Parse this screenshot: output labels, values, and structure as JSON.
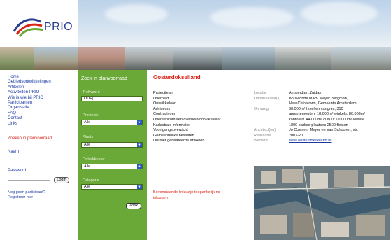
{
  "logo": {
    "text": "PRIO"
  },
  "leftnav": {
    "items": [
      "Home",
      "Gebiedsontwikkelingen",
      "Artikelen",
      "Activiteiten PRIO",
      "Wie is wie bij PRIO",
      "Participanten",
      "Organisatie",
      "FAQ",
      "Contact",
      "Links"
    ],
    "search_link": "Zoeken in planvoorraad",
    "name_label": "Naam",
    "password_label": "Password",
    "login_label": "Login",
    "no_participant": "Nog geen participant?",
    "register_prefix": "Registreer ",
    "register_link": "hier"
  },
  "search": {
    "title": "Zoek in planvoorraad",
    "trefwoord_label": "Trefwoord",
    "trefwoord_value": "ODE|",
    "provincie_label": "Provincie",
    "provincie_value": "Alle",
    "plaats_label": "Plaats",
    "plaats_value": "Alle",
    "ontwikkelaar_label": "Ontwikkelaar",
    "ontwikkelaar_value": "Alle",
    "categorie_label": "Categorie",
    "categorie_value": "Alle",
    "zoek_label": "Zoek"
  },
  "project": {
    "title": "Oosterdokseiland",
    "links": [
      "Projectteam",
      "Overheid",
      "Ontwikkelaar",
      "Adviseurs",
      "Contractvorm",
      "Overeenkomsten overheid/ontwikkelaar",
      "Kadastrale informatie",
      "Voortgangsoverzicht",
      "Gemeentelijke besluiten",
      "Dossier gerelateerde artikelen"
    ],
    "notice": "Bovenstaande links zijn toegankelijk na inloggen",
    "info": [
      {
        "k": "Locatie",
        "v": "Amsterdam,Zuidas"
      },
      {
        "k": "Ontwikkelaar(s)",
        "v": "Bouwfonds MAB, Meyer Bergman,"
      },
      {
        "k": "",
        "v": "New Chinatown, Gemeente Amsterdam"
      },
      {
        "k": "Omvang",
        "v": "30.000m² hotel en congres, 310"
      },
      {
        "k": "",
        "v": "appartementen, 18.000m² winkels, 80.000m²"
      },
      {
        "k": "",
        "v": "kantoren. 44.000m² cultuur 10.000m² leisure."
      },
      {
        "k": "",
        "v": "1800 parkeerplaatsen  2500 fietsen"
      },
      {
        "k": "Architect(en)",
        "v": "Jo Coenen, Meyer en Van Schooten, etc"
      },
      {
        "k": "Realisatie",
        "v": "2007-2011"
      },
      {
        "k": "Website",
        "v": "www.oosterdokseiland.nl",
        "link": true
      }
    ]
  }
}
